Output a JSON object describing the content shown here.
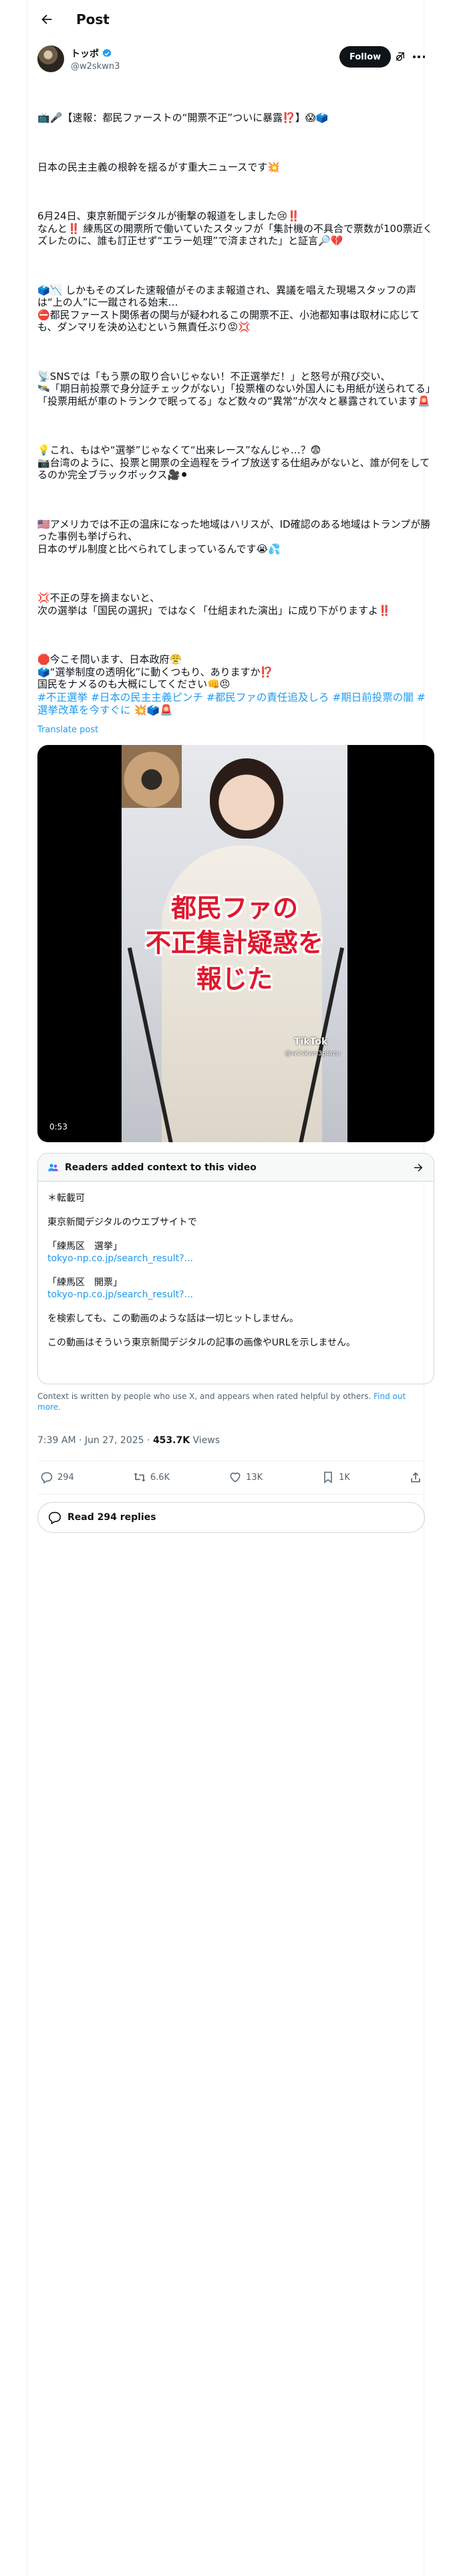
{
  "header": {
    "title": "Post"
  },
  "author": {
    "display_name": "トッポ",
    "handle": "@w2skwn3",
    "follow_label": "Follow"
  },
  "post": {
    "paragraphs": [
      "📺🎤【速報：都民ファーストの“開票不正”ついに暴露⁉️】😱🗳️",
      "日本の民主主義の根幹を揺るがす重大ニュースです💥",
      "6月24日、東京新聞デジタルが衝撃の報道をしました😢‼️\nなんと‼️ 練馬区の開票所で働いていたスタッフが「集計機の不具合で票数が100票近くズレたのに、誰も訂正せず“エラー処理”で済まされた」と証言🔎💔",
      "🗳️📉 しかもそのズレた速報値がそのまま報道され、異議を唱えた現場スタッフの声は“上の人”に一蹴される始末…\n⛔都民ファースト関係者の関与が疑われるこの開票不正、小池都知事は取材に応じても、ダンマリを決め込むという無責任ぶり😡💢",
      "📡SNSでは「もう票の取り合いじゃない！不正選挙だ！」と怒号が飛び交い、\n🛰️「期日前投票で身分証チェックがない」「投票権のない外国人にも用紙が送られてる」「投票用紙が車のトランクで眠ってる」など数々の“異常”が次々と暴露されています🚨",
      "💡これ、もはや“選挙”じゃなくて“出来レース”なんじゃ…？😨\n📷台湾のように、投票と開票の全過程をライブ放送する仕組みがないと、誰が何をしてるのか完全ブラックボックス🎥⚫",
      "🇺🇸アメリカでは不正の温床になった地域はハリスが、ID確認のある地域はトランプが勝った事例も挙げられ、\n日本のザル制度と比べられてしまっているんです😭💦",
      "💢不正の芽を摘まないと、\n次の選挙は「国民の選択」ではなく「仕組まれた演出」に成り下がりますよ‼️",
      "🛑今こそ問います、日本政府😤\n🗳️“選挙制度の透明化”に動くつもり、ありますか⁉️\n国民をナメるのも大概にしてください👊😠"
    ],
    "hashtags": [
      "#不正選挙",
      "#日本の民主主義ピンチ",
      "#都民ファの責任追及しろ",
      "#期日前投票の闇",
      "#選挙改革を今すぐに"
    ],
    "hashtag_trailing_emoji": "💥🗳️🚨",
    "translate_label": "Translate post"
  },
  "video": {
    "caption_lines": [
      "都民ファの",
      "不正集計疑惑を",
      "報じた"
    ],
    "watermark": "TikTok",
    "watermark_handle": "@w2skwn3piazu",
    "duration": "0:53"
  },
  "community_note": {
    "title": "Readers added context to this video",
    "lines": {
      "l1": "＊転載可",
      "l2": "東京新聞デジタルのウエブサイトで",
      "q1": "「練馬区　選挙」",
      "link1": "tokyo-np.co.jp/search_result?...",
      "q2": "「練馬区　開票」",
      "link2": "tokyo-np.co.jp/search_result?...",
      "l3": "を検索しても、この動画のような話は一切ヒットしません。",
      "l4": "この動画はそういう東京新聞デジタルの記事の画像やURLを示しません。"
    },
    "footer": "Context is written by people who use X, and appears when rated helpful by others.",
    "footer_link": "Find out more."
  },
  "meta": {
    "time": "7:39 AM · Jun 27, 2025",
    "separator": " · ",
    "views_count": "453.7K",
    "views_label": "Views"
  },
  "actions": {
    "replies": "294",
    "reposts": "6.6K",
    "likes": "13K",
    "bookmarks": "1K"
  },
  "read_replies_label": "Read 294 replies"
}
